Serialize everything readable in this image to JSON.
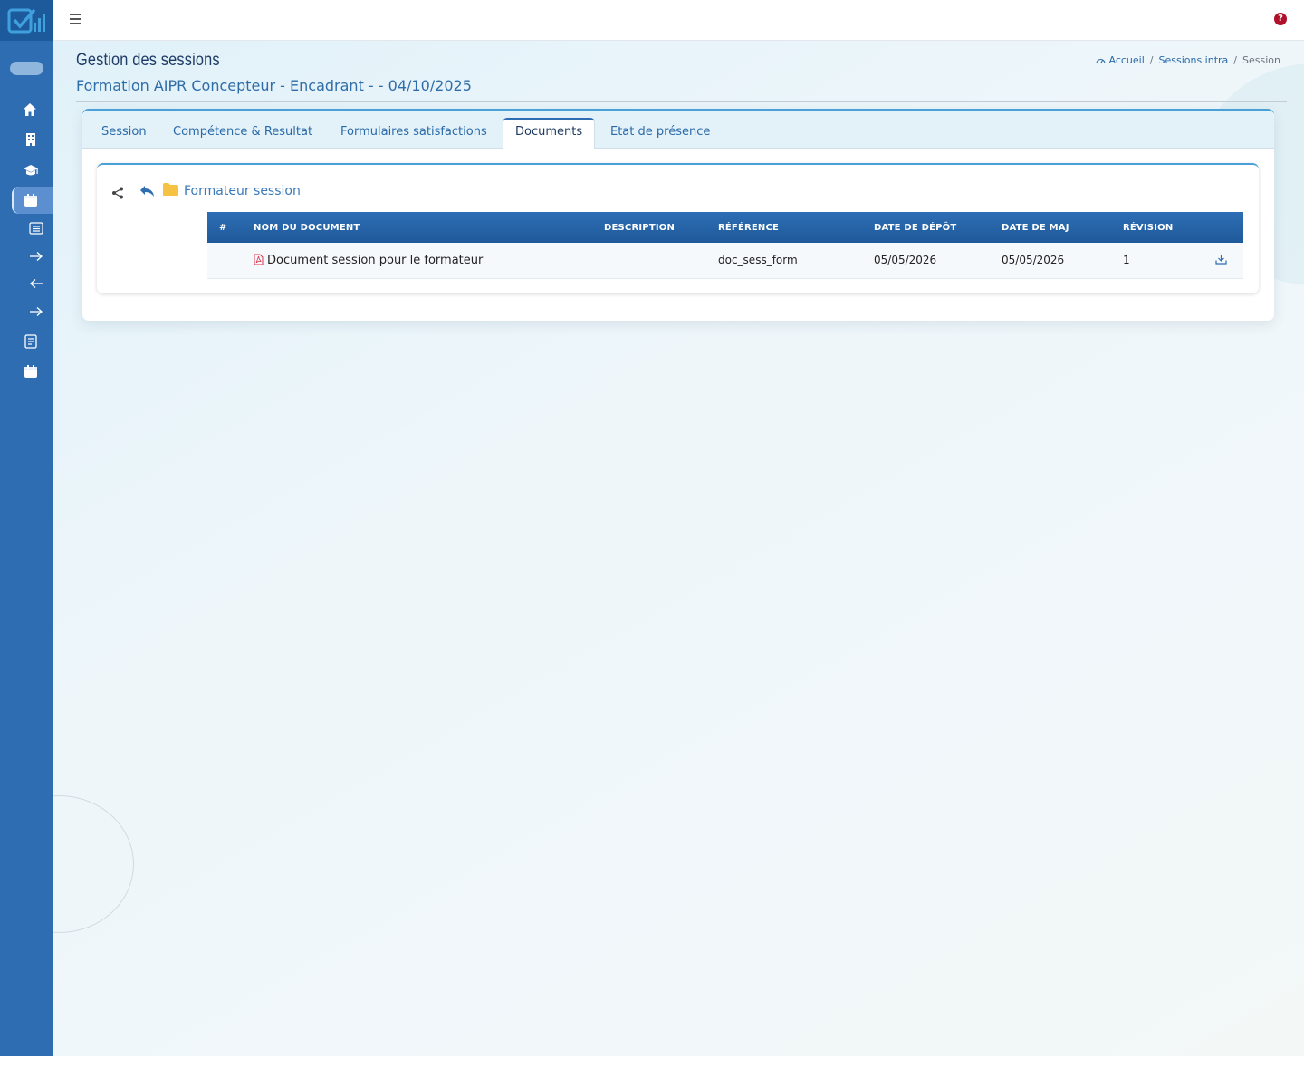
{
  "colors": {
    "sidebar": "#2f6db3",
    "accent": "#2a6aa8",
    "table_header": "#2e6eb5",
    "help": "#b0102a",
    "folder": "#f5c242",
    "pdf": "#d9364f"
  },
  "sidebar": {
    "logo": "app-logo",
    "items": [
      {
        "icon": "home-icon"
      },
      {
        "icon": "building-icon"
      },
      {
        "icon": "graduation-cap-icon"
      },
      {
        "icon": "calendar-icon",
        "active": true
      },
      {
        "icon": "list-icon"
      },
      {
        "icon": "arrow-right-icon"
      },
      {
        "icon": "arrow-left-icon"
      },
      {
        "icon": "arrow-right-icon"
      },
      {
        "icon": "document-icon"
      },
      {
        "icon": "calendar-icon"
      }
    ]
  },
  "topbar": {
    "help_label": "?"
  },
  "header": {
    "title": "Gestion des sessions",
    "subtitle": "Formation AIPR Concepteur - Encadrant - - 04/10/2025"
  },
  "breadcrumb": {
    "home": "Accueil",
    "sep": "/",
    "sessions": "Sessions intra",
    "current": "Session"
  },
  "tabs": [
    {
      "label": "Session"
    },
    {
      "label": "Compétence & Resultat"
    },
    {
      "label": "Formulaires satisfactions"
    },
    {
      "label": "Documents",
      "active": true
    },
    {
      "label": "Etat de présence"
    }
  ],
  "documents": {
    "folder": "Formateur session",
    "columns": [
      "#",
      "NOM DU DOCUMENT",
      "DESCRIPTION",
      "RÉFÉRENCE",
      "DATE DE DÉPÔT",
      "DATE DE MAJ",
      "RÉVISION"
    ],
    "rows": [
      {
        "num": "",
        "name": "Document session pour le formateur",
        "description": "",
        "reference": "doc_sess_form",
        "deposit_date": "05/05/2026",
        "update_date": "05/05/2026",
        "revision": "1"
      }
    ]
  }
}
